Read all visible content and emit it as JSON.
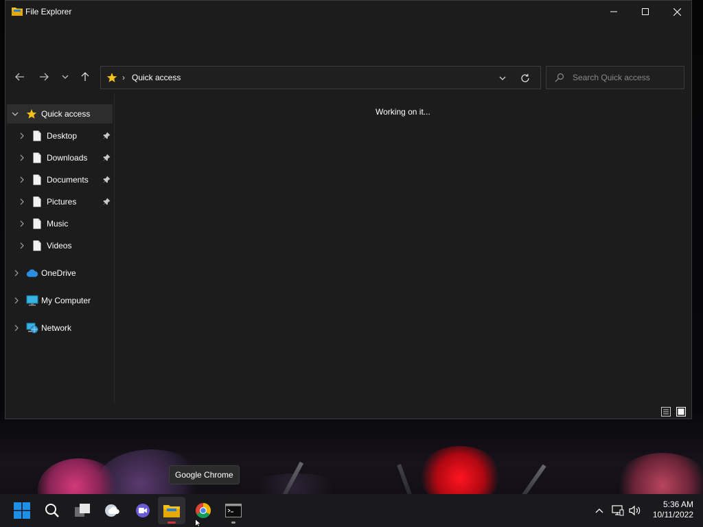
{
  "window": {
    "title": "File Explorer",
    "minimize_icon": "minimize-icon",
    "maximize_icon": "maximize-icon",
    "close_icon": "close-icon"
  },
  "navigation": {
    "back_icon": "arrow-left-icon",
    "forward_icon": "arrow-right-icon",
    "recent_icon": "chevron-down-icon",
    "up_icon": "arrow-up-icon"
  },
  "address_bar": {
    "separator": "›",
    "location": "Quick access"
  },
  "search": {
    "placeholder": "Search Quick access"
  },
  "sidebar": {
    "quick_access": "Quick access",
    "pinned": [
      {
        "label": "Desktop",
        "pinned": true
      },
      {
        "label": "Downloads",
        "pinned": true
      },
      {
        "label": "Documents",
        "pinned": true
      },
      {
        "label": "Pictures",
        "pinned": true
      },
      {
        "label": "Music",
        "pinned": false
      },
      {
        "label": "Videos",
        "pinned": false
      }
    ],
    "onedrive": "OneDrive",
    "my_computer": "My Computer",
    "network": "Network"
  },
  "content": {
    "status_message": "Working on it..."
  },
  "tooltip": {
    "text": "Google Chrome"
  },
  "taskbar": {
    "apps": [
      "start-icon",
      "search-icon",
      "task-view-icon",
      "widgets-icon",
      "chat-icon",
      "file-explorer-icon",
      "chrome-icon",
      "terminal-icon"
    ],
    "time": "5:36 AM",
    "date": "10/11/2022"
  },
  "colors": {
    "window_bg": "#1c1c1c",
    "folder_yellow": "#f5c21b",
    "accent_red": "#d13438",
    "windows_blue": "#1e90e8"
  }
}
